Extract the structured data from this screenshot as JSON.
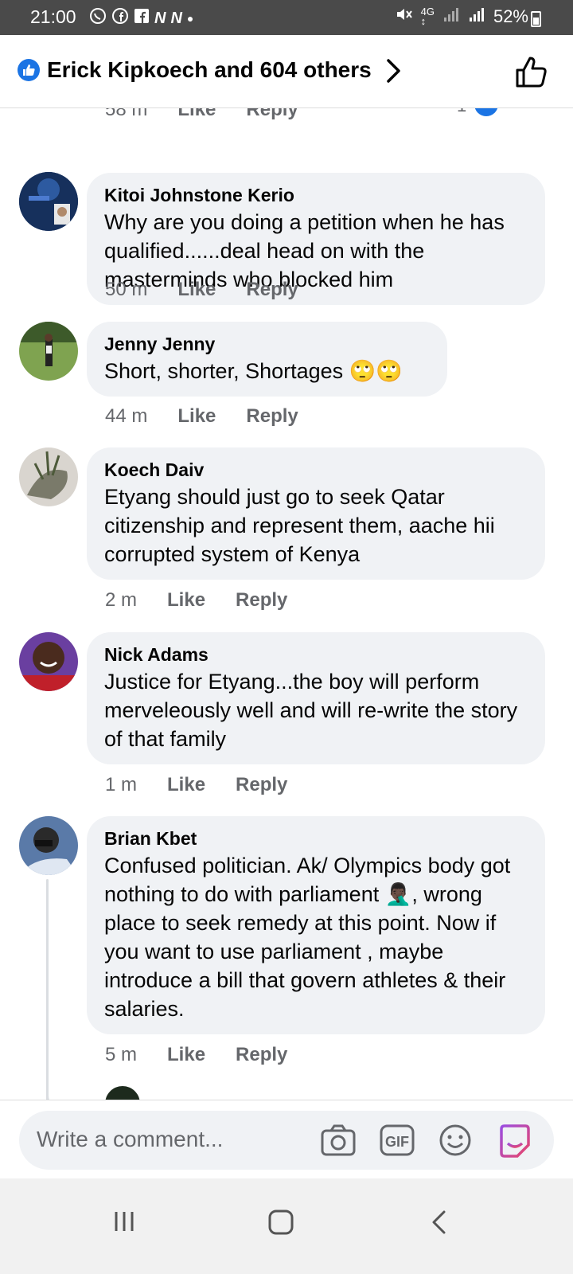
{
  "status_bar": {
    "time": "21:00",
    "battery": "52%"
  },
  "header": {
    "title": "Erick Kipkoech and 604 others"
  },
  "comments": [
    {
      "author": "Kitoi Johnstone Kerio",
      "text": "Why are you doing a petition when he has qualified......deal head on with the masterminds who blocked him",
      "time": "50 m"
    },
    {
      "author": "Jenny Jenny",
      "text": "Short, shorter, Shortages 🙄🙄",
      "time": "44 m"
    },
    {
      "author": "Koech Daiv",
      "text": "Etyang should just go to  seek Qatar citizenship and represent them, aache hii corrupted system of Kenya",
      "time": "2 m"
    },
    {
      "author": "Nick Adams",
      "text": "Justice for Etyang...the boy will perform merveleously well and will re-write the story of that family",
      "time": "1 m"
    },
    {
      "author": "Brian Kbet",
      "text": "Confused politician. Ak/ Olympics body got nothing to do with parliament 🤦🏿‍♂️, wrong place to seek remedy at this point. Now if you want to use parliament , maybe introduce a bill that govern athletes & their salaries.",
      "time": "5 m"
    }
  ],
  "actions": {
    "like": "Like",
    "reply": "Reply"
  },
  "composer": {
    "placeholder": "Write a comment..."
  },
  "icons": {
    "like_badge": "like-badge-icon",
    "chevron": "chevron-right-icon",
    "thumb": "thumbs-up-icon",
    "camera": "camera-icon",
    "gif": "gif-icon",
    "emoji": "emoji-icon",
    "sticker": "sticker-icon"
  },
  "colors": {
    "brand_blue": "#1b74e4",
    "bubble_bg": "#f0f2f5",
    "secondary_text": "#65676b"
  }
}
